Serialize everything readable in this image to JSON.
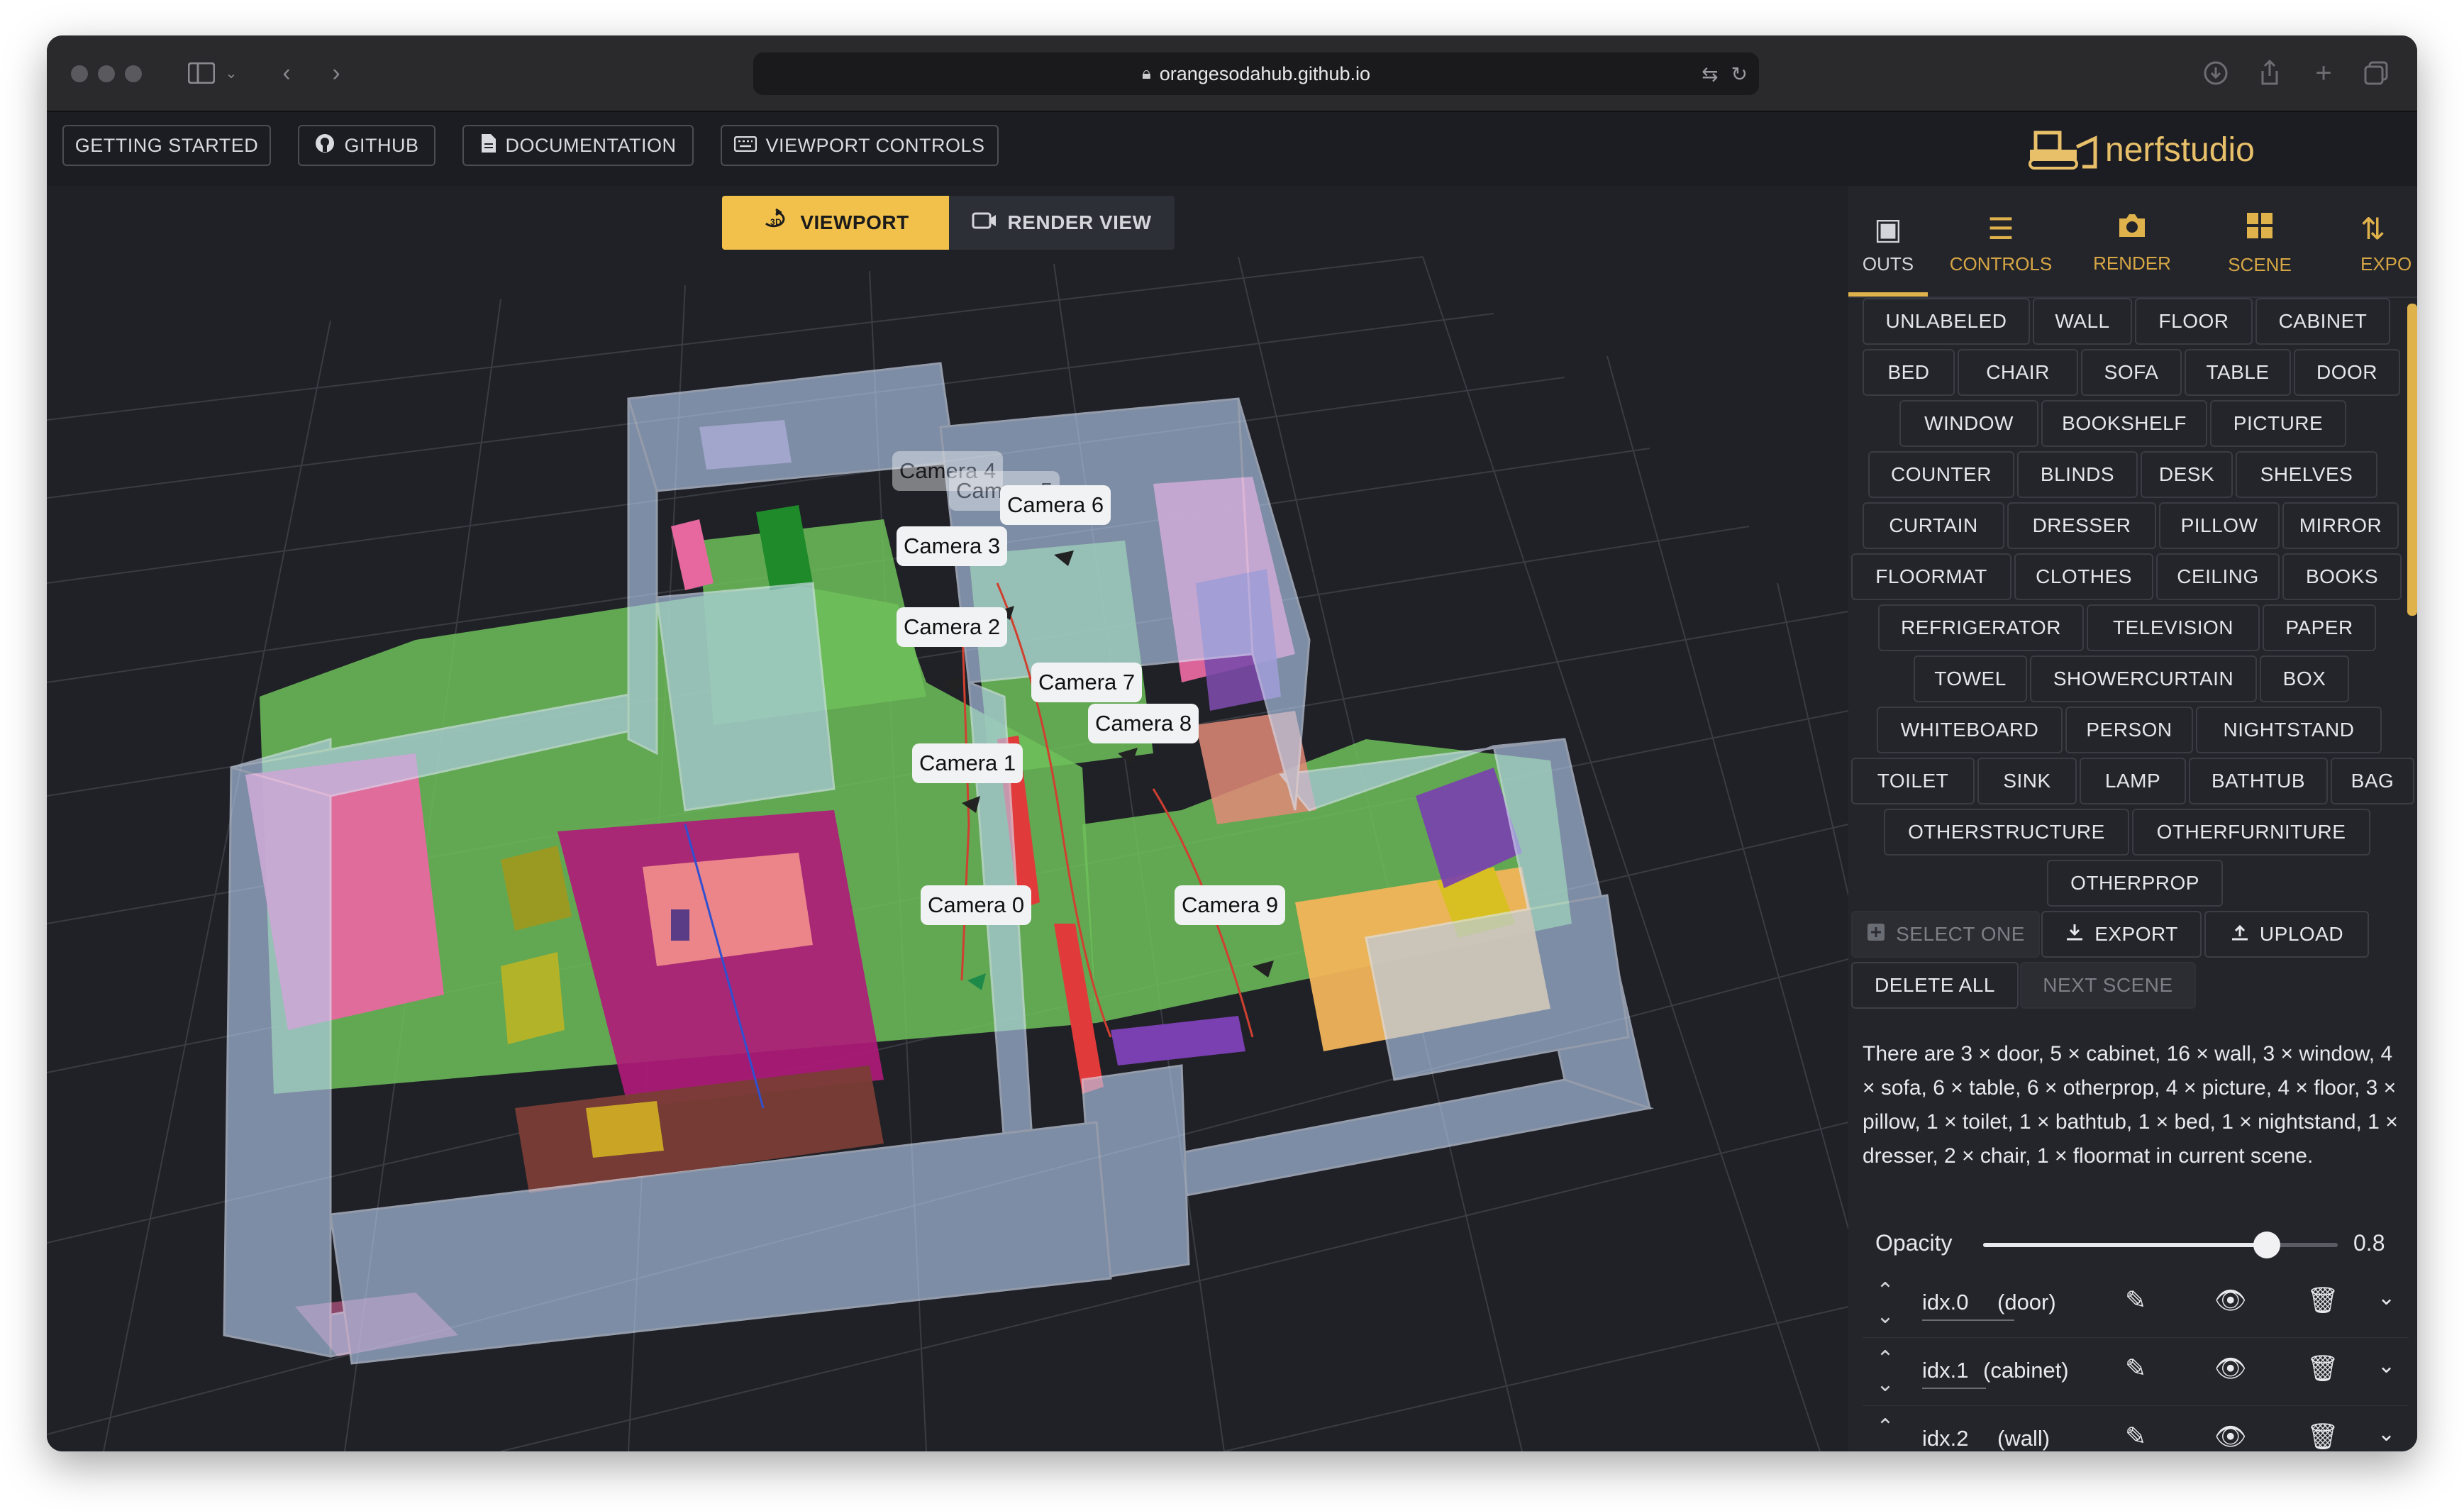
{
  "browser": {
    "url": "orangesodahub.github.io"
  },
  "appbar": {
    "buttons": [
      {
        "label": "GETTING STARTED",
        "icon": ""
      },
      {
        "label": "GITHUB",
        "icon": "github-icon"
      },
      {
        "label": "DOCUMENTATION",
        "icon": "document-icon"
      },
      {
        "label": "VIEWPORT CONTROLS",
        "icon": "keyboard-icon"
      }
    ],
    "logo_text": "nerfstudio"
  },
  "view_toggle": {
    "viewport": "VIEWPORT",
    "render_view": "RENDER VIEW"
  },
  "cameras": [
    "Camera 0",
    "Camera 1",
    "Camera 2",
    "Camera 3",
    "Camera 6",
    "Camera 7",
    "Camera 8",
    "Camera 9",
    "Camera 4",
    "Camera 5"
  ],
  "tabs": [
    {
      "label": "OUTS",
      "icon": "layout-icon"
    },
    {
      "label": "CONTROLS",
      "icon": "sliders-icon"
    },
    {
      "label": "RENDER",
      "icon": "camera-icon"
    },
    {
      "label": "SCENE",
      "icon": "grid-icon"
    },
    {
      "label": "EXPO",
      "icon": "export-icon"
    }
  ],
  "labels": [
    [
      "UNLABELED",
      "WALL",
      "FLOOR",
      "CABINET"
    ],
    [
      "BED",
      "CHAIR",
      "SOFA",
      "TABLE",
      "DOOR"
    ],
    [
      "WINDOW",
      "BOOKSHELF",
      "PICTURE"
    ],
    [
      "COUNTER",
      "BLINDS",
      "DESK",
      "SHELVES"
    ],
    [
      "CURTAIN",
      "DRESSER",
      "PILLOW",
      "MIRROR"
    ],
    [
      "FLOORMAT",
      "CLOTHES",
      "CEILING",
      "BOOKS"
    ],
    [
      "REFRIGERATOR",
      "TELEVISION",
      "PAPER"
    ],
    [
      "TOWEL",
      "SHOWERCURTAIN",
      "BOX"
    ],
    [
      "WHITEBOARD",
      "PERSON",
      "NIGHTSTAND"
    ],
    [
      "TOILET",
      "SINK",
      "LAMP",
      "BATHTUB",
      "BAG"
    ],
    [
      "OTHERSTRUCTURE",
      "OTHERFURNITURE"
    ],
    [
      "OTHERPROP"
    ]
  ],
  "actions": {
    "select_one": "SELECT ONE",
    "export": "EXPORT",
    "upload": "UPLOAD",
    "delete_all": "DELETE ALL",
    "next_scene": "NEXT SCENE"
  },
  "summary": "There are 3 × door, 5 × cabinet, 16 × wall, 3 × window, 4 × sofa, 6 × table, 6 × otherprop, 4 × picture, 4 × floor, 3 × pillow, 1 × toilet, 1 × bathtub, 1 × bed, 1 × nightstand, 1 × dresser, 2 × chair, 1 × floormat in current scene.",
  "opacity": {
    "label": "Opacity",
    "value": "0.8",
    "fraction": 0.8
  },
  "instances": [
    {
      "idx": "idx.0",
      "type": "(door)"
    },
    {
      "idx": "idx.1",
      "type": "(cabinet)"
    },
    {
      "idx": "idx.2",
      "type": "(wall)"
    }
  ],
  "colors": {
    "accent": "#f2c14b",
    "panel_bg": "#24252b",
    "viewport_bg": "#202127"
  }
}
